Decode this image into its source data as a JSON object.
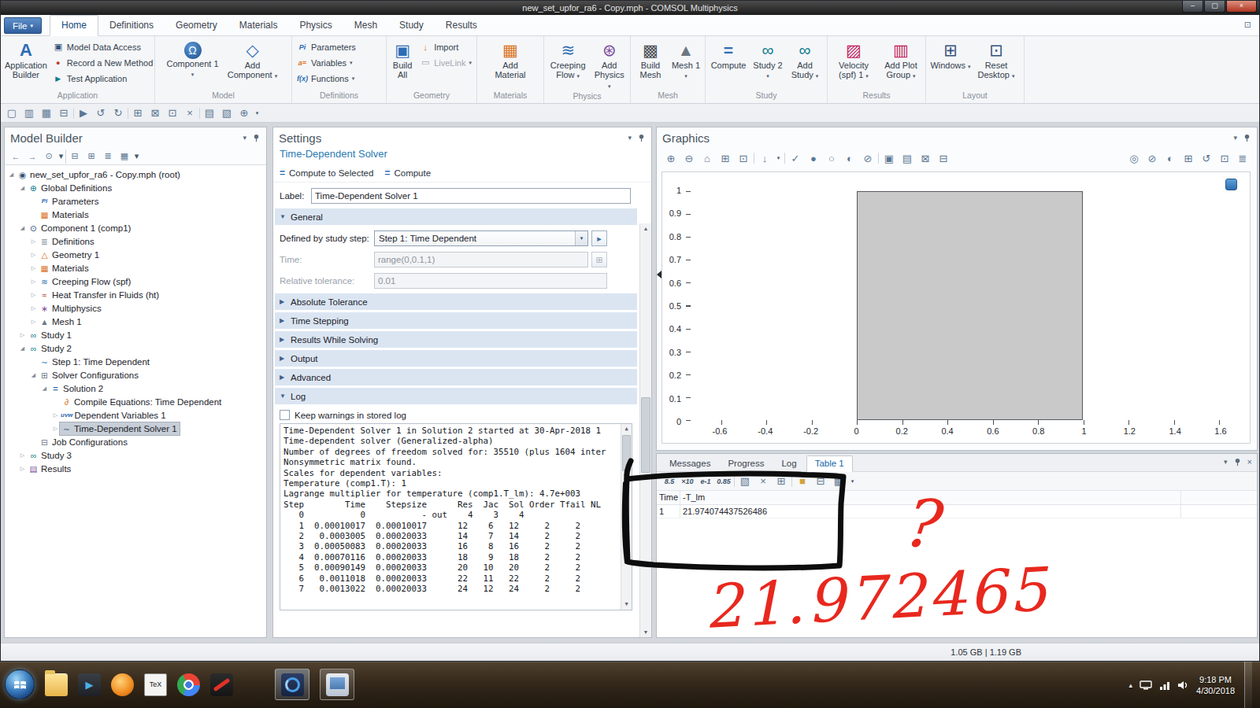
{
  "glyphs": {
    "caret": "▾"
  },
  "window": {
    "title": "new_set_upfor_ra6 - Copy.mph - COMSOL Multiphysics",
    "minimize": "–",
    "maximize": "▢",
    "close": "×",
    "status_memory": "1.05 GB | 1.19 GB"
  },
  "ribbon": {
    "file": {
      "label": "File"
    },
    "display_options_icon": "⊡",
    "tabs": [
      {
        "label": "Home",
        "cls": "active",
        "name": "tab-home"
      },
      {
        "label": "Definitions",
        "cls": "",
        "name": "tab-definitions"
      },
      {
        "label": "Geometry",
        "cls": "",
        "name": "tab-geometry"
      },
      {
        "label": "Materials",
        "cls": "",
        "name": "tab-materials"
      },
      {
        "label": "Physics",
        "cls": "",
        "name": "tab-physics"
      },
      {
        "label": "Mesh",
        "cls": "",
        "name": "tab-mesh"
      },
      {
        "label": "Study",
        "cls": "",
        "name": "tab-study"
      },
      {
        "label": "Results",
        "cls": "",
        "name": "tab-results"
      }
    ],
    "application": {
      "group": "Application",
      "builder": {
        "label": "Application Builder",
        "icon": "A"
      },
      "data_access": {
        "label": "Model Data Access",
        "icon": "▣"
      },
      "record": {
        "label": "Record a New Method",
        "icon": "●"
      },
      "test": {
        "label": "Test Application",
        "icon": "▶"
      }
    },
    "model": {
      "group": "Model",
      "component": {
        "label": "Component 1",
        "icon": "Ω"
      },
      "add_component": {
        "label": "Add Component",
        "icon": "◇"
      }
    },
    "definitions": {
      "group": "Definitions",
      "parameters": {
        "label": "Parameters",
        "icon": "Pi"
      },
      "variables": {
        "label": "Variables",
        "icon": "a="
      },
      "functions": {
        "label": "Functions",
        "icon": "f(x)"
      }
    },
    "geometry": {
      "group": "Geometry",
      "build_all": {
        "label": "Build All",
        "icon": "▣"
      },
      "import": {
        "label": "Import",
        "icon": "↓"
      },
      "livelink": {
        "label": "LiveLink",
        "icon": "▭"
      }
    },
    "materials": {
      "group": "Materials",
      "add_material": {
        "label": "Add Material",
        "icon": "▦"
      }
    },
    "physics": {
      "group": "Physics",
      "creeping_flow": {
        "label": "Creeping Flow",
        "icon": "≋"
      },
      "add_physics": {
        "label": "Add Physics",
        "icon": "⊛"
      }
    },
    "mesh": {
      "group": "Mesh",
      "build_mesh": {
        "label": "Build Mesh",
        "icon": "▩"
      },
      "mesh1": {
        "label": "Mesh 1",
        "icon": "▲"
      }
    },
    "study": {
      "group": "Study",
      "compute": {
        "label": "Compute",
        "icon": "="
      },
      "study2": {
        "label": "Study 2",
        "icon": "∞"
      },
      "add_study": {
        "label": "Add Study",
        "icon": "∞"
      }
    },
    "results": {
      "group": "Results",
      "velocity": {
        "label": "Velocity (spf) 1",
        "icon": "▨"
      },
      "add_plot_group": {
        "label": "Add Plot Group",
        "icon": "▥"
      }
    },
    "layout": {
      "group": "Layout",
      "windows": {
        "label": "Windows",
        "icon": "⊞"
      },
      "reset_desktop": {
        "label": "Reset Desktop",
        "icon": "⊡"
      }
    }
  },
  "qat": {
    "icons": [
      {
        "n": "new-file-icon",
        "g": "▢",
        "cls": "",
        "it": "true"
      },
      {
        "n": "open-file-icon",
        "g": "▥",
        "cls": "",
        "it": "true"
      },
      {
        "n": "save-icon",
        "g": "▦",
        "cls": "",
        "it": "true"
      },
      {
        "n": "print-icon",
        "g": "⊟",
        "cls": "",
        "it": "true"
      },
      {
        "n": "separator",
        "g": "",
        "cls": "sep",
        "it": "false"
      },
      {
        "n": "run-icon",
        "g": "▶",
        "cls": "c-run",
        "it": "true"
      },
      {
        "n": "undo-icon",
        "g": "↺",
        "cls": "",
        "it": "true"
      },
      {
        "n": "redo-icon",
        "g": "↻",
        "cls": "",
        "it": "true"
      },
      {
        "n": "separator",
        "g": "",
        "cls": "sep",
        "it": "false"
      },
      {
        "n": "copy-icon",
        "g": "⊞",
        "cls": "",
        "it": "true"
      },
      {
        "n": "paste-icon",
        "g": "⊠",
        "cls": "",
        "it": "true"
      },
      {
        "n": "duplicate-icon",
        "g": "⊡",
        "cls": "",
        "it": "true"
      },
      {
        "n": "delete-icon",
        "g": "×",
        "cls": "",
        "it": "true"
      },
      {
        "n": "separator",
        "g": "",
        "cls": "sep",
        "it": "false"
      },
      {
        "n": "select-block-icon",
        "g": "▤",
        "cls": "",
        "it": "true"
      },
      {
        "n": "unselect-block-icon",
        "g": "▧",
        "cls": "",
        "it": "true"
      },
      {
        "n": "zoom-box-icon",
        "g": "⊕",
        "cls": "",
        "it": "true"
      },
      {
        "n": "qat-menu-caret",
        "g": "▾",
        "cls": "mini",
        "it": "true"
      }
    ]
  },
  "model_builder": {
    "title": "Model Builder",
    "toolbar": [
      {
        "n": "back-icon",
        "g": "←",
        "cls": "",
        "it": "true"
      },
      {
        "n": "forward-icon",
        "g": "→",
        "cls": "",
        "it": "true"
      },
      {
        "n": "node-visibility-icon",
        "g": "⊙",
        "cls": "",
        "it": "true"
      },
      {
        "n": "node-visibility-caret",
        "g": "▾",
        "cls": "mini",
        "it": "true"
      },
      {
        "n": "separator",
        "g": "",
        "cls": "sep",
        "it": "false"
      },
      {
        "n": "collapse-all-icon",
        "g": "⊟",
        "cls": "",
        "it": "true"
      },
      {
        "n": "expand-all-icon",
        "g": "⊞",
        "cls": "",
        "it": "true"
      },
      {
        "n": "sort-icon",
        "g": "≣",
        "cls": "",
        "it": "true"
      },
      {
        "n": "model-tree-settings-icon",
        "g": "▦",
        "cls": "",
        "it": "true"
      },
      {
        "n": "model-tree-settings-caret",
        "g": "▾",
        "cls": "mini",
        "it": "true"
      }
    ],
    "tree": [
      {
        "cls": "lv0",
        "ex": "◢",
        "icon": "◉",
        "icls": "c-navy",
        "iname": "model-root-icon",
        "label": "new_set_upfor_ra6 - Copy.mph (root)"
      },
      {
        "cls": "lv1",
        "ex": "◢",
        "icon": "⊕",
        "icls": "c-teal",
        "iname": "global-definitions-icon",
        "label": "Global Definitions"
      },
      {
        "cls": "lv2",
        "ex": "",
        "icon": "Pi",
        "icls": "c-blue tx",
        "iname": "parameters-icon",
        "label": "Parameters"
      },
      {
        "cls": "lv2",
        "ex": "",
        "icon": "▦",
        "icls": "c-orange",
        "iname": "materials-icon",
        "label": "Materials"
      },
      {
        "cls": "lv1",
        "ex": "◢",
        "icon": "⊙",
        "icls": "c-navy",
        "iname": "component-icon",
        "label": "Component 1 (comp1)"
      },
      {
        "cls": "lv2",
        "ex": "▷",
        "icon": "≣",
        "icls": "c-gray",
        "iname": "definitions-icon",
        "label": "Definitions"
      },
      {
        "cls": "lv2",
        "ex": "▷",
        "icon": "△",
        "icls": "c-orange",
        "iname": "geometry-icon",
        "label": "Geometry 1"
      },
      {
        "cls": "lv2",
        "ex": "▷",
        "icon": "▦",
        "icls": "c-orange",
        "iname": "materials-icon",
        "label": "Materials"
      },
      {
        "cls": "lv2",
        "ex": "▷",
        "icon": "≋",
        "icls": "c-blue",
        "iname": "creeping-flow-icon",
        "label": "Creeping Flow (spf)"
      },
      {
        "cls": "lv2",
        "ex": "▷",
        "icon": "≈",
        "icls": "c-red",
        "iname": "heat-transfer-icon",
        "label": "Heat Transfer in Fluids (ht)"
      },
      {
        "cls": "lv2",
        "ex": "▷",
        "icon": "∗",
        "icls": "c-purple",
        "iname": "multiphysics-icon",
        "label": "Multiphysics"
      },
      {
        "cls": "lv2",
        "ex": "▷",
        "icon": "▲",
        "icls": "c-gray",
        "iname": "mesh-icon",
        "label": "Mesh 1"
      },
      {
        "cls": "lv1",
        "ex": "▷",
        "icon": "∞",
        "icls": "c-teal",
        "iname": "study-icon",
        "label": "Study 1"
      },
      {
        "cls": "lv1",
        "ex": "◢",
        "icon": "∞",
        "icls": "c-teal",
        "iname": "study-icon",
        "label": "Study 2"
      },
      {
        "cls": "lv2",
        "ex": "",
        "icon": "∼",
        "icls": "c-blue",
        "iname": "time-dependent-step-icon",
        "label": "Step 1: Time Dependent"
      },
      {
        "cls": "lv2",
        "ex": "◢",
        "icon": "⊞",
        "icls": "c-gray",
        "iname": "solver-configurations-icon",
        "label": "Solver Configurations"
      },
      {
        "cls": "lv3",
        "ex": "◢",
        "icon": "=",
        "icls": "c-blue tx2",
        "iname": "solution-icon",
        "label": "Solution 2"
      },
      {
        "cls": "lv4",
        "ex": "",
        "icon": "∂",
        "icls": "c-orange",
        "iname": "compile-equations-icon",
        "label": "Compile Equations: Time Dependent"
      },
      {
        "cls": "lv4",
        "ex": "▷",
        "icon": "uvw",
        "icls": "c-blue tx",
        "iname": "dependent-variables-icon",
        "label": "Dependent Variables 1"
      },
      {
        "cls": "lv4 sel",
        "ex": "▷",
        "icon": "∼",
        "icls": "c-navy",
        "iname": "time-dependent-solver-icon",
        "label": "Time-Dependent Solver 1"
      },
      {
        "cls": "lv2",
        "ex": "",
        "icon": "⊟",
        "icls": "c-gray",
        "iname": "job-configurations-icon",
        "label": "Job Configurations"
      },
      {
        "cls": "lv1",
        "ex": "▷",
        "icon": "∞",
        "icls": "c-teal",
        "iname": "study-icon",
        "label": "Study 3"
      },
      {
        "cls": "lv1",
        "ex": "▷",
        "icon": "▤",
        "icls": "c-purple",
        "iname": "results-icon",
        "label": "Results"
      }
    ]
  },
  "settings": {
    "title": "Settings",
    "subtitle": "Time-Dependent Solver",
    "compute_to_selected": "Compute to Selected",
    "compute": "Compute",
    "label_caption": "Label:",
    "label_value": "Time-Dependent Solver 1",
    "general_section": "General",
    "section_expanded_arrow": "▼",
    "section_collapsed_arrow": "▶",
    "defined_by_label": "Defined by study step:",
    "defined_by_value": "Step 1: Time Dependent",
    "go_to_step_icon": "▸",
    "time_label": "Time:",
    "time_value": "range(0,0.1,1)",
    "range_icon": "⊞",
    "rel_tol_label": "Relative tolerance:",
    "rel_tol_value": "0.01",
    "collapsed_sections": [
      {
        "name": "section-absolute-tolerance",
        "label": "Absolute Tolerance"
      },
      {
        "name": "section-time-stepping",
        "label": "Time Stepping"
      },
      {
        "name": "section-results-while-solving",
        "label": "Results While Solving"
      },
      {
        "name": "section-output",
        "label": "Output"
      },
      {
        "name": "section-advanced",
        "label": "Advanced"
      }
    ],
    "log_section": "Log",
    "keep_warnings_label": "Keep warnings in stored log",
    "log_lines": [
      "Time-Dependent Solver 1 in Solution 2 started at 30-Apr-2018 1",
      "Time-dependent solver (Generalized-alpha)",
      "Number of degrees of freedom solved for: 35510 (plus 1604 inter",
      "Nonsymmetric matrix found.",
      "Scales for dependent variables:",
      "Temperature (comp1.T): 1",
      "Lagrange multiplier for temperature (comp1.T_lm): 4.7e+003",
      "Step        Time    Stepsize      Res  Jac  Sol Order Tfail NL",
      "   0           0           - out    4    3    4",
      "   1  0.00010017  0.00010017      12    6   12     2     2",
      "   2   0.0003005  0.00020033      14    7   14     2     2",
      "   3  0.00050083  0.00020033      16    8   16     2     2",
      "   4  0.00070116  0.00020033      18    9   18     2     2",
      "   5  0.00090149  0.00020033      20   10   20     2     2",
      "   6   0.0011018  0.00020033      22   11   22     2     2",
      "   7   0.0013022  0.00020033      24   12   24     2     2"
    ]
  },
  "graphics": {
    "title": "Graphics",
    "toolbar_left": [
      {
        "n": "zoom-in-icon",
        "g": "⊕",
        "cls": "",
        "it": "true"
      },
      {
        "n": "zoom-out-icon",
        "g": "⊖",
        "cls": "",
        "it": "true"
      },
      {
        "n": "zoom-extents-icon",
        "g": "⌂",
        "cls": "",
        "it": "true"
      },
      {
        "n": "zoom-box-icon",
        "g": "⊞",
        "cls": "",
        "it": "true"
      },
      {
        "n": "go-to-default-view-icon",
        "g": "⊡",
        "cls": "",
        "it": "true"
      },
      {
        "n": "separator",
        "g": "",
        "cls": "sep",
        "it": "false"
      },
      {
        "n": "view-orientation-icon",
        "g": "↓",
        "cls": "",
        "it": "true"
      },
      {
        "n": "view-orientation-caret",
        "g": "▾",
        "cls": "mini",
        "it": "true"
      },
      {
        "n": "separator",
        "g": "",
        "cls": "sep",
        "it": "false"
      },
      {
        "n": "select-mode-icon",
        "g": "✓",
        "cls": "c-green",
        "it": "true"
      },
      {
        "n": "surface-render-icon",
        "g": "●",
        "cls": "c-blue",
        "it": "true"
      },
      {
        "n": "wireframe-render-icon",
        "g": "○",
        "cls": "c-blue",
        "it": "true"
      },
      {
        "n": "transparency-icon",
        "g": "◐",
        "cls": "c-blue",
        "it": "true"
      },
      {
        "n": "clipping-icon",
        "g": "⊘",
        "cls": "",
        "it": "true"
      },
      {
        "n": "separator",
        "g": "",
        "cls": "sep",
        "it": "false"
      },
      {
        "n": "scene-snapshot-icon",
        "g": "▣",
        "cls": "",
        "it": "true"
      },
      {
        "n": "thumbnail-icon",
        "g": "▤",
        "cls": "",
        "it": "true"
      },
      {
        "n": "select-box-icon",
        "g": "⊠",
        "cls": "",
        "it": "true"
      },
      {
        "n": "deselect-box-icon",
        "g": "⊟",
        "cls": "",
        "it": "true"
      }
    ],
    "toolbar_right": [
      {
        "n": "view-visibility-icon",
        "g": "◎",
        "cls": "",
        "it": "true"
      },
      {
        "n": "hide-objects-icon",
        "g": "⊘",
        "cls": "",
        "it": "true"
      },
      {
        "n": "transparency-toggle-icon",
        "g": "◐",
        "cls": "",
        "it": "true"
      },
      {
        "n": "wireframe-toggle-icon",
        "g": "⊞",
        "cls": "",
        "it": "true"
      },
      {
        "n": "reset-hiding-icon",
        "g": "↺",
        "cls": "",
        "it": "true"
      },
      {
        "n": "snapshot-camera-icon",
        "g": "⊡",
        "cls": "c-blue",
        "it": "true"
      },
      {
        "n": "print-plot-icon",
        "g": "≣",
        "cls": "",
        "it": "true"
      }
    ],
    "y_ticks": [
      "1",
      "0.9",
      "0.8",
      "0.7",
      "0.6",
      "0.5",
      "0.4",
      "0.3",
      "0.2",
      "0.1",
      "0"
    ],
    "x_ticks": [
      "-0.6",
      "-0.4",
      "-0.2",
      "0",
      "0.2",
      "0.4",
      "0.6",
      "0.8",
      "1",
      "1.2",
      "1.4",
      "1.6"
    ],
    "geometry_rectangle": {
      "x_min": 0,
      "x_max": 1,
      "y_min": 0,
      "y_max": 1
    }
  },
  "table_panel": {
    "tabs": [
      {
        "label": "Messages",
        "cls": "",
        "name": "tab-messages"
      },
      {
        "label": "Progress",
        "cls": "",
        "name": "tab-progress"
      },
      {
        "label": "Log",
        "cls": "",
        "name": "tab-log"
      },
      {
        "label": "Table 1",
        "cls": "active",
        "name": "tab-table-1"
      }
    ],
    "toolbar": [
      {
        "n": "full-precision-icon",
        "g": "8.5",
        "cls": "tx",
        "it": "true"
      },
      {
        "n": "scientific-notation-icon",
        "g": "×10",
        "cls": "tx",
        "it": "true"
      },
      {
        "n": "engineering-notation-icon",
        "g": "e-1",
        "cls": "tx",
        "it": "true"
      },
      {
        "n": "decimal-notation-icon",
        "g": "0.85",
        "cls": "tx",
        "it": "true"
      },
      {
        "n": "separator",
        "g": "",
        "cls": "sep",
        "it": "false"
      },
      {
        "n": "paint-icon",
        "g": "▧",
        "cls": "c-blue",
        "it": "true"
      },
      {
        "n": "clear-table-icon",
        "g": "×",
        "cls": "",
        "it": "true"
      },
      {
        "n": "export-table-icon",
        "g": "⊞",
        "cls": "",
        "it": "true"
      },
      {
        "n": "separator",
        "g": "",
        "cls": "sep",
        "it": "false"
      },
      {
        "n": "color-swatch-icon",
        "g": "■",
        "cls": "c-swatch",
        "it": "true"
      },
      {
        "n": "copy-table-icon",
        "g": "⊟",
        "cls": "",
        "it": "true"
      },
      {
        "n": "dock-table-icon",
        "g": "▦",
        "cls": "",
        "it": "true"
      },
      {
        "n": "table-menu-caret",
        "g": "▾",
        "cls": "mini",
        "it": "true"
      }
    ],
    "columns": [
      "Time",
      "-T_lm"
    ],
    "rows": [
      [
        "1",
        "21.974074437526486"
      ]
    ]
  },
  "annotations": {
    "question_mark": "?",
    "number": "21.972465"
  },
  "taskbar": {
    "tex_label": "TeX",
    "clock_time": "9:18 PM",
    "clock_date": "4/30/2018"
  }
}
